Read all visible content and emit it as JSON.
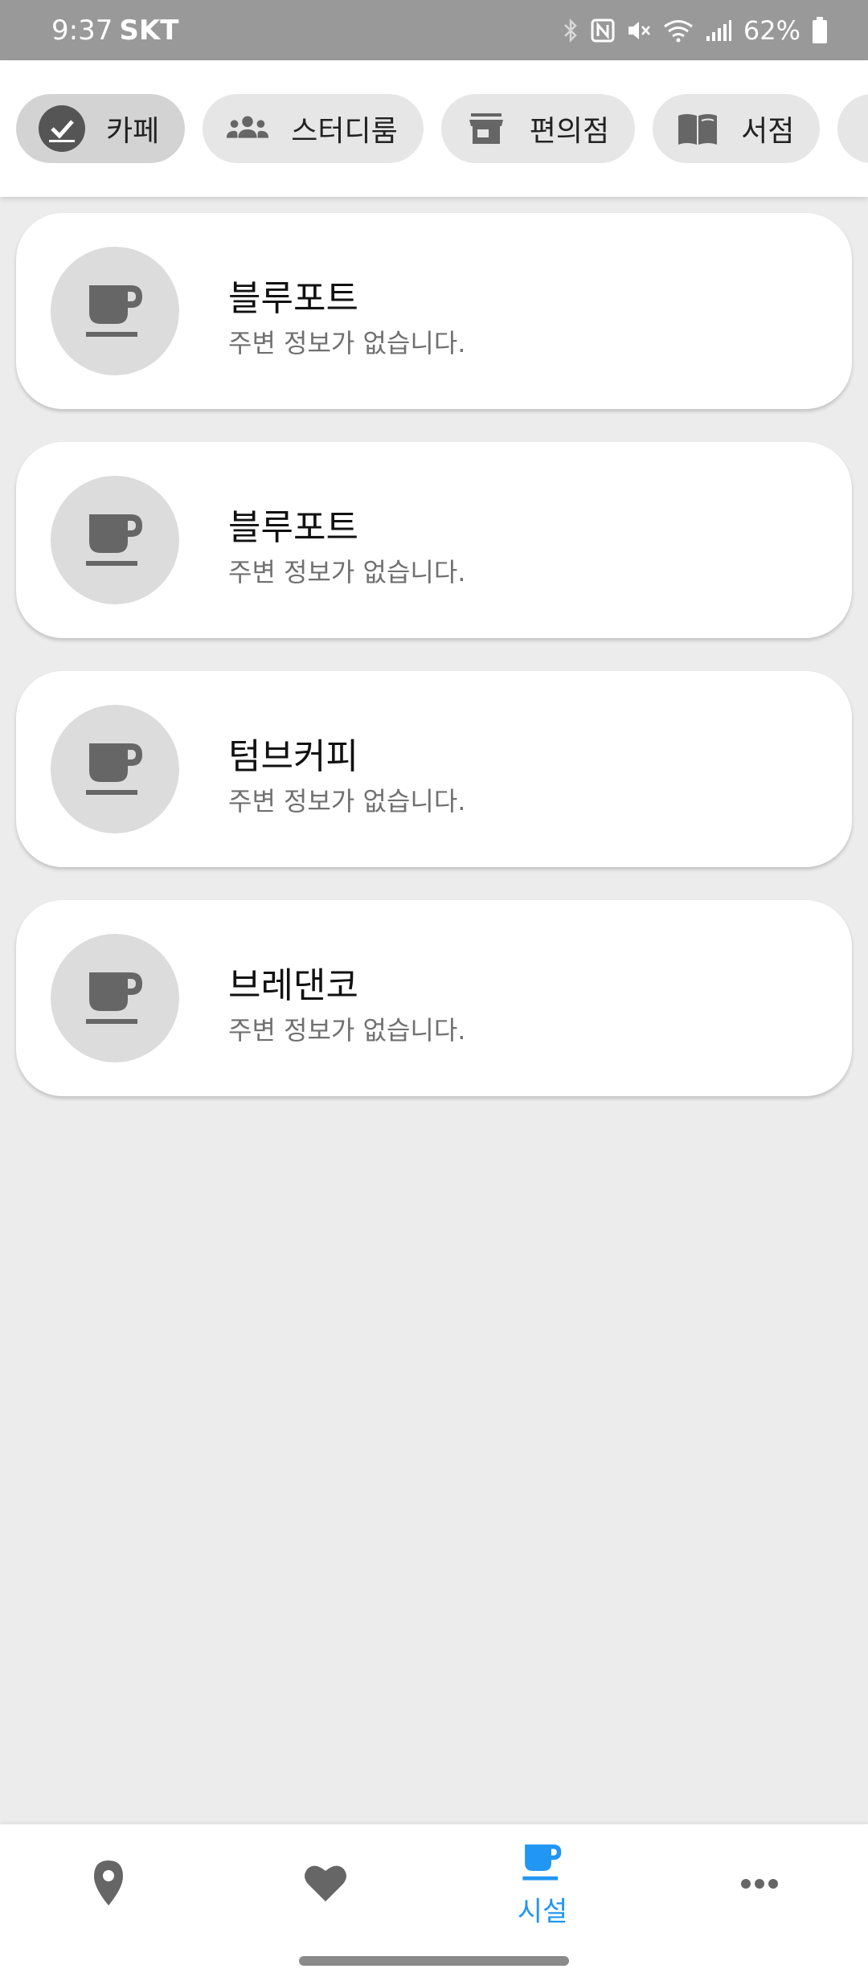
{
  "status_bar": {
    "time": "9:37",
    "carrier": "SKT",
    "battery": "62%"
  },
  "categories": [
    {
      "label": "카페",
      "icon": "check-icon",
      "selected": true
    },
    {
      "label": "스터디룸",
      "icon": "people-icon",
      "selected": false
    },
    {
      "label": "편의점",
      "icon": "store-icon",
      "selected": false
    },
    {
      "label": "서점",
      "icon": "book-icon",
      "selected": false
    }
  ],
  "places": [
    {
      "name": "블루포트",
      "subtitle": "주변 정보가 없습니다.",
      "icon": "coffee-cup-icon"
    },
    {
      "name": "블루포트",
      "subtitle": "주변 정보가 없습니다.",
      "icon": "coffee-cup-icon"
    },
    {
      "name": "텀브커피",
      "subtitle": "주변 정보가 없습니다.",
      "icon": "coffee-cup-icon"
    },
    {
      "name": "브레댄코",
      "subtitle": "주변 정보가 없습니다.",
      "icon": "coffee-cup-icon"
    }
  ],
  "bottom_nav": {
    "items": [
      {
        "icon": "map-pin-icon",
        "label": "",
        "active": false
      },
      {
        "icon": "heart-icon",
        "label": "",
        "active": false
      },
      {
        "icon": "coffee-cup-icon",
        "label": "시설",
        "active": true
      },
      {
        "icon": "more-icon",
        "label": "",
        "active": false
      }
    ],
    "active_color": "#2196f3",
    "inactive_color": "#666666"
  },
  "colors": {
    "background": "#ececec",
    "status_bar": "#999999",
    "icon_gray": "#666666",
    "accent": "#2196f3"
  }
}
